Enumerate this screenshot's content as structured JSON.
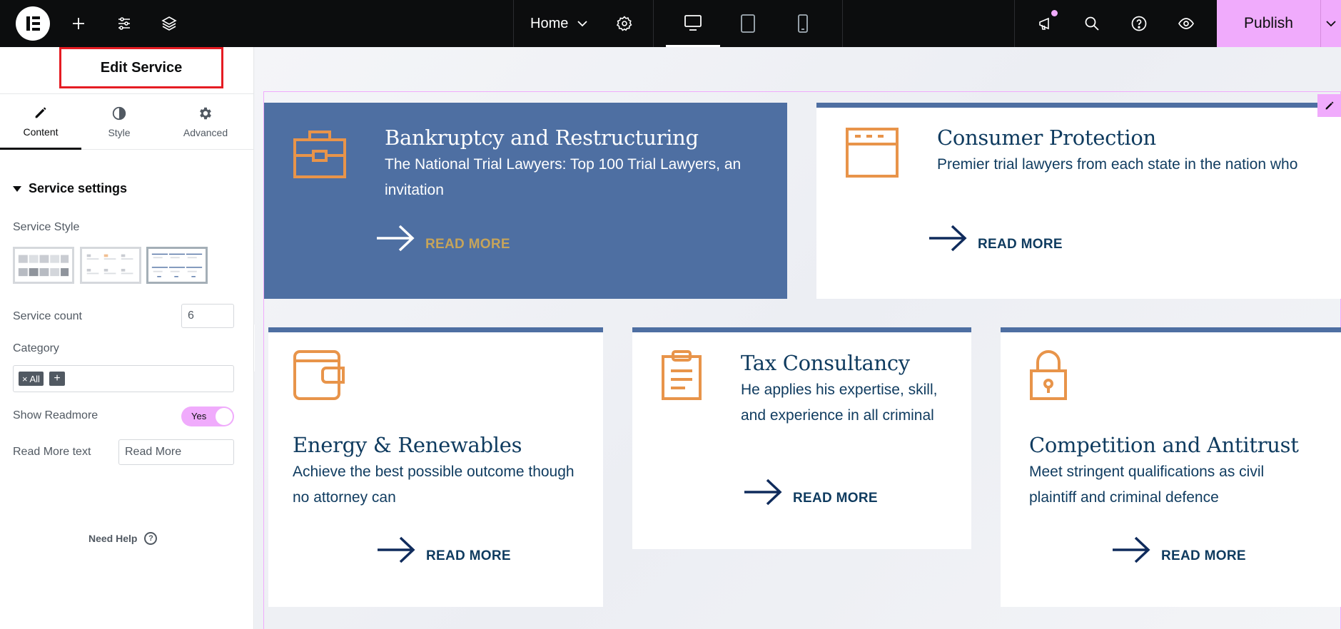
{
  "topbar": {
    "page_name": "Home",
    "publish_label": "Publish",
    "icons": [
      "elementor-logo-icon",
      "add-icon",
      "site-settings-icon",
      "structure-icon",
      "page-settings-icon",
      "desktop-icon",
      "tablet-icon",
      "mobile-icon",
      "announcements-icon",
      "search-icon",
      "help-icon",
      "preview-icon",
      "chevron-down-icon"
    ]
  },
  "panel": {
    "title": "Edit Service",
    "tabs": [
      {
        "label": "Content",
        "icon": "pencil-icon",
        "active": true
      },
      {
        "label": "Style",
        "icon": "half-circle-icon",
        "active": false
      },
      {
        "label": "Advanced",
        "icon": "gear-icon",
        "active": false
      }
    ],
    "section_title": "Service settings",
    "service_style_label": "Service Style",
    "service_count_label": "Service count",
    "service_count_value": "6",
    "category_label": "Category",
    "category_tag": "× All",
    "category_add": "+",
    "show_readmore_label": "Show Readmore",
    "show_readmore_value": "Yes",
    "read_more_text_label": "Read More text",
    "read_more_text_value": "Read More",
    "need_help": "Need Help",
    "help_glyph": "?"
  },
  "cards": [
    {
      "title": "Bankruptcy and Restructuring",
      "desc": "The National Trial Lawyers: Top 100 Trial Lawyers, an invitation",
      "read_more": "READ MORE",
      "icon": "briefcase-icon"
    },
    {
      "title": "Consumer Protection",
      "desc": "Premier trial lawyers from each state in the nation who",
      "read_more": "READ MORE",
      "icon": "browser-window-icon"
    },
    {
      "title": "Energy & Renewables",
      "desc": "Achieve the best possible outcome though no attorney can",
      "read_more": "READ MORE",
      "icon": "wallet-icon"
    },
    {
      "title": "Tax Consultancy",
      "desc": "He applies his expertise, skill, and experience in all criminal",
      "read_more": "READ MORE",
      "icon": "clipboard-icon"
    },
    {
      "title": "Competition and Antitrust",
      "desc": "Meet stringent qualifications as civil plaintiff and criminal defence",
      "read_more": "READ MORE",
      "icon": "padlock-icon"
    }
  ],
  "colors": {
    "accent": "#f0abfc",
    "card_blue": "#4e6fa2",
    "text_navy": "#0f3b5f",
    "icon_orange": "#e8944a",
    "featured_readmore": "#c6a45a"
  }
}
